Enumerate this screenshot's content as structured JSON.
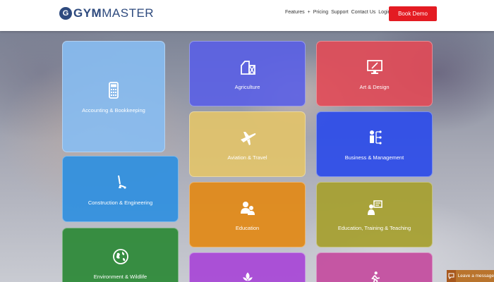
{
  "header": {
    "logo_mark": "G",
    "logo_gym": "GYM",
    "logo_master": "MASTER",
    "nav": [
      "Features",
      "Pricing",
      "Support",
      "Contact Us",
      "Login"
    ],
    "nav_separator": "+",
    "book_demo": "Book Demo"
  },
  "tiles": [
    {
      "label": "Accounting & Bookkeeping",
      "color": "#87bdf2",
      "icon": "calculator-icon"
    },
    {
      "label": "Agriculture",
      "color": "#5a5fe6",
      "icon": "barn-icon"
    },
    {
      "label": "Art & Design",
      "color": "#e24a56",
      "icon": "monitor-icon"
    },
    {
      "label": "Aviation & Travel",
      "color": "#e2c36a",
      "icon": "airplane-icon"
    },
    {
      "label": "Business & Management",
      "color": "#2f4ee8",
      "icon": "org-chart-icon"
    },
    {
      "label": "Construction & Engineering",
      "color": "#2f8fe0",
      "icon": "shovel-icon"
    },
    {
      "label": "Education",
      "color": "#e08a1a",
      "icon": "people-icon"
    },
    {
      "label": "Education, Training & Teaching",
      "color": "#a6a033",
      "icon": "teacher-icon"
    },
    {
      "label": "Environment & Wildlife",
      "color": "#2f8a3a",
      "icon": "globe-icon"
    },
    {
      "label": "",
      "color": "#a94ad6",
      "icon": "leaf-icon"
    },
    {
      "label": "",
      "color": "#c44fa0",
      "icon": "runner-icon"
    }
  ],
  "chat": {
    "label": "Leave a message"
  }
}
